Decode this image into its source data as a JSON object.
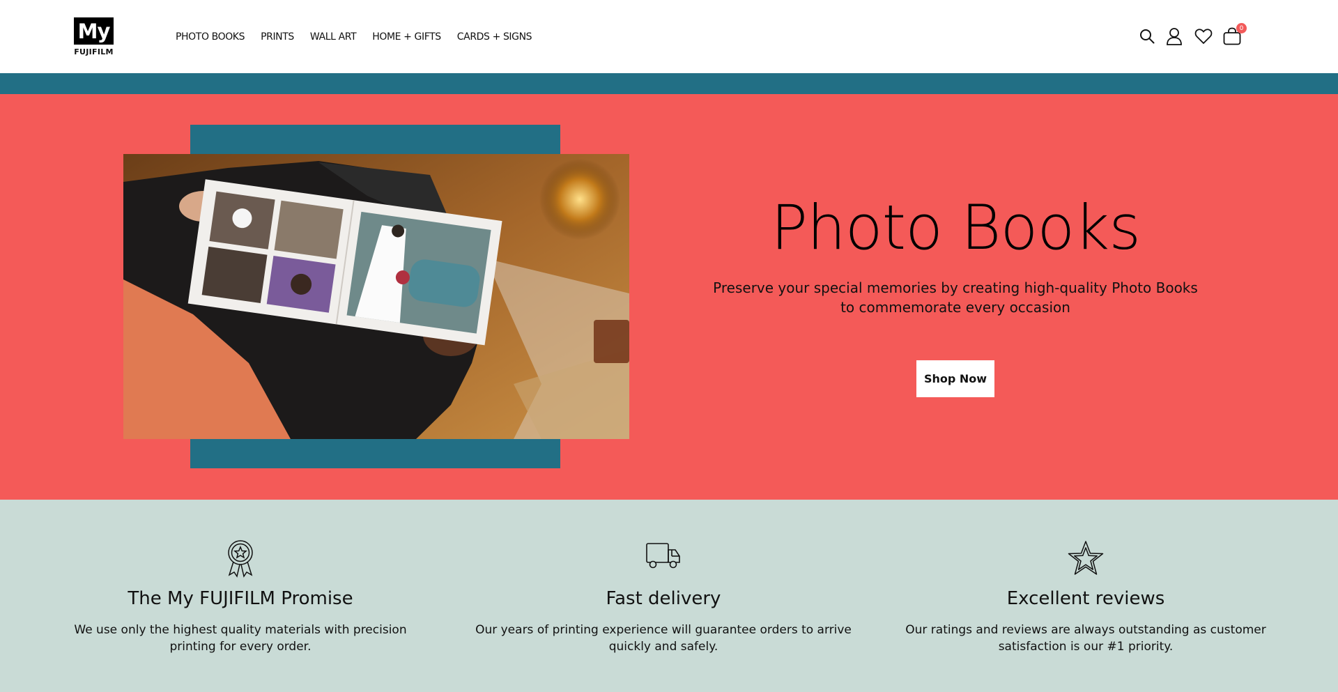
{
  "header": {
    "logo_top": "My",
    "logo_bottom": "FUJIFILM",
    "nav": [
      {
        "label": "PHOTO BOOKS"
      },
      {
        "label": "PRINTS"
      },
      {
        "label": "WALL ART"
      },
      {
        "label": "HOME + GIFTS"
      },
      {
        "label": "CARDS + SIGNS"
      }
    ],
    "icons": [
      "search-icon",
      "account-icon",
      "wishlist-heart-icon",
      "cart-bag-icon"
    ],
    "cart_count": "0"
  },
  "hero": {
    "title": "Photo Books",
    "subtitle": "Preserve your special memories by creating high-quality Photo Books to commemorate every occasion",
    "cta_label": "Shop Now",
    "image_alt": "Person flipping through a wedding photo book on a wooden table",
    "colors": {
      "background": "#f45a58",
      "accent": "#226f85"
    }
  },
  "features": [
    {
      "icon": "award-ribbon-icon",
      "title": "The My FUJIFILM Promise",
      "text": "We use only the highest quality materials with precision printing for every order."
    },
    {
      "icon": "delivery-truck-icon",
      "title": "Fast delivery",
      "text": "Our years of printing experience will guarantee orders to arrive quickly and safely."
    },
    {
      "icon": "star-icon",
      "title": "Excellent reviews",
      "text": "Our ratings and reviews are always outstanding as customer satisfaction is our #1 priority."
    }
  ],
  "colors": {
    "feature_bg": "#c9dbd6",
    "teal_bar": "#226f85",
    "badge": "#f25a5a"
  }
}
